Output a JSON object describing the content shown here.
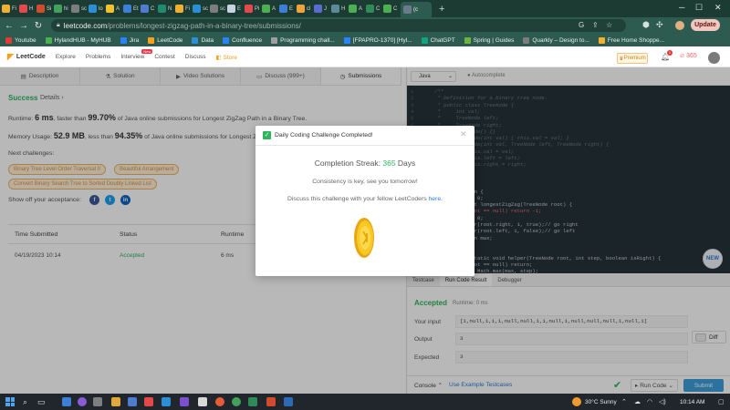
{
  "browser": {
    "tabs": [
      "Fi",
      "H",
      "Si",
      "hi",
      "sc",
      "lo",
      "A",
      "Et",
      "C",
      "N",
      "Fi",
      "sc",
      "sc",
      "E",
      "Pi",
      "A",
      "E",
      "cl",
      "J",
      "H",
      "A",
      "C",
      "C",
      "(c"
    ],
    "url_host": "leetcode.com",
    "url_path": "/problems/longest-zigzag-path-in-a-binary-tree/submissions/",
    "update_label": "Update",
    "bookmarks": [
      "Youtube",
      "HylandHUB - MyHUB",
      "Jira",
      "LeetCode",
      "Data",
      "Confluence",
      "Programming chall...",
      "[FPAPRO-1370] [Hyl...",
      "ChatGPT",
      "Spring | Guides",
      "Quarkly – Design to...",
      "Free Home Shoppe..."
    ]
  },
  "lc_nav": {
    "logo": "LeetCode",
    "items": [
      "Explore",
      "Problems",
      "Interview",
      "Contest",
      "Discuss",
      "Store"
    ],
    "new_badge": "New",
    "premium": "Premium",
    "notif_count": "1",
    "streak": "365"
  },
  "left_tabs": [
    "Description",
    "Solution",
    "Video Solutions",
    "Discuss (999+)",
    "Submissions"
  ],
  "result": {
    "status": "Success",
    "details": "Details",
    "runtime_prefix": "Runtime: ",
    "runtime_value": "6 ms",
    "runtime_mid": ", faster than ",
    "runtime_pct": "99.70%",
    "runtime_suffix": " of Java online submissions for Longest ZigZag Path in a Binary Tree.",
    "memory_prefix": "Memory Usage: ",
    "memory_value": "52.9 MB",
    "memory_mid": ", less than ",
    "memory_pct": "94.35%",
    "memory_suffix": " of Java online submissions for Longest ZigZag",
    "next_challenges_label": "Next challenges:",
    "challenges": [
      "Binary Tree Level Order Traversal II",
      "Beautiful Arrangement",
      "Convert Binary Search Tree to Sorted Doubly Linked List"
    ],
    "show_off": "Show off your acceptance:"
  },
  "submissions_table": {
    "headers": [
      "Time Submitted",
      "Status",
      "Runtime"
    ],
    "rows": [
      {
        "time": "04/19/2023 10:14",
        "status": "Accepted",
        "runtime": "6 ms"
      }
    ]
  },
  "editor": {
    "language": "Java",
    "autocomplete": "Autocomplete",
    "line_numbers": [
      "1",
      "2",
      "3",
      "4",
      "5",
      "6",
      "7",
      "8",
      "9",
      "10",
      "11",
      "12",
      "13",
      "14",
      "15",
      "16",
      "17",
      "18",
      "19",
      "20",
      "21",
      "22",
      "23",
      "24",
      "25",
      "26",
      "27",
      "28"
    ],
    "code_lines": [
      "/**",
      " * Definition for a binary tree node.",
      " * public class TreeNode {",
      " *     int val;",
      " *     TreeNode left;",
      " *     TreeNode right;",
      " *     TreeNode() {}",
      " *     TreeNode(int val) { this.val = val; }",
      " *     TreeNode(int val, TreeNode left, TreeNode right) {",
      " *         this.val = val;",
      " *         this.left = left;",
      " *         this.right = right;",
      " *     }",
      " * }",
      " */",
      "class Solution {",
      "    int max = 0;",
      "    public int longestZigZag(TreeNode root) {",
      "        if(root == null) return -1;",
      "        max = 0;",
      "        helper(root.right, 1, true);// go right",
      "        helper(root.left, 1, false);// go left",
      "        return max;",
      "    }",
      "",
      "    private static void helper(TreeNode root, int step, boolean isRight) {",
      "        if(root == null) return;",
      "        max = Math.max(max, step);"
    ],
    "new_label": "NEW"
  },
  "result_panel": {
    "tabs": [
      "Testcase",
      "Run Code Result",
      "Debugger"
    ],
    "status": "Accepted",
    "runtime": "Runtime: 0 ms",
    "input_label": "Your input",
    "input_value": "[1,null,1,1,1,null,null,1,1,null,1,null,null,null,1,null,1]",
    "output_label": "Output",
    "output_value": "3",
    "expected_label": "Expected",
    "expected_value": "3",
    "diff_label": "Diff"
  },
  "footer": {
    "console": "Console",
    "use_example": "Use Example Testcases",
    "run_code": "Run Code",
    "submit": "Submit"
  },
  "modal": {
    "title": "Daily Coding Challenge Completed!",
    "streak_label": "Completion Streak: ",
    "streak_value": "365",
    "streak_unit": " Days",
    "line1": "Consistency is key, see you tomorrow!",
    "line2_prefix": "Discuss this challenge with your fellow LeetCoders ",
    "line2_link": "here",
    "line2_suffix": "."
  },
  "taskbar": {
    "temperature": "30°C",
    "condition": "Sunny",
    "time": "10:14 AM"
  },
  "colors": {
    "accent_green": "#2db55d",
    "chip_orange": "#e0932e",
    "browser_green": "#2e5b4f",
    "submit_blue": "#3d9fdb"
  }
}
